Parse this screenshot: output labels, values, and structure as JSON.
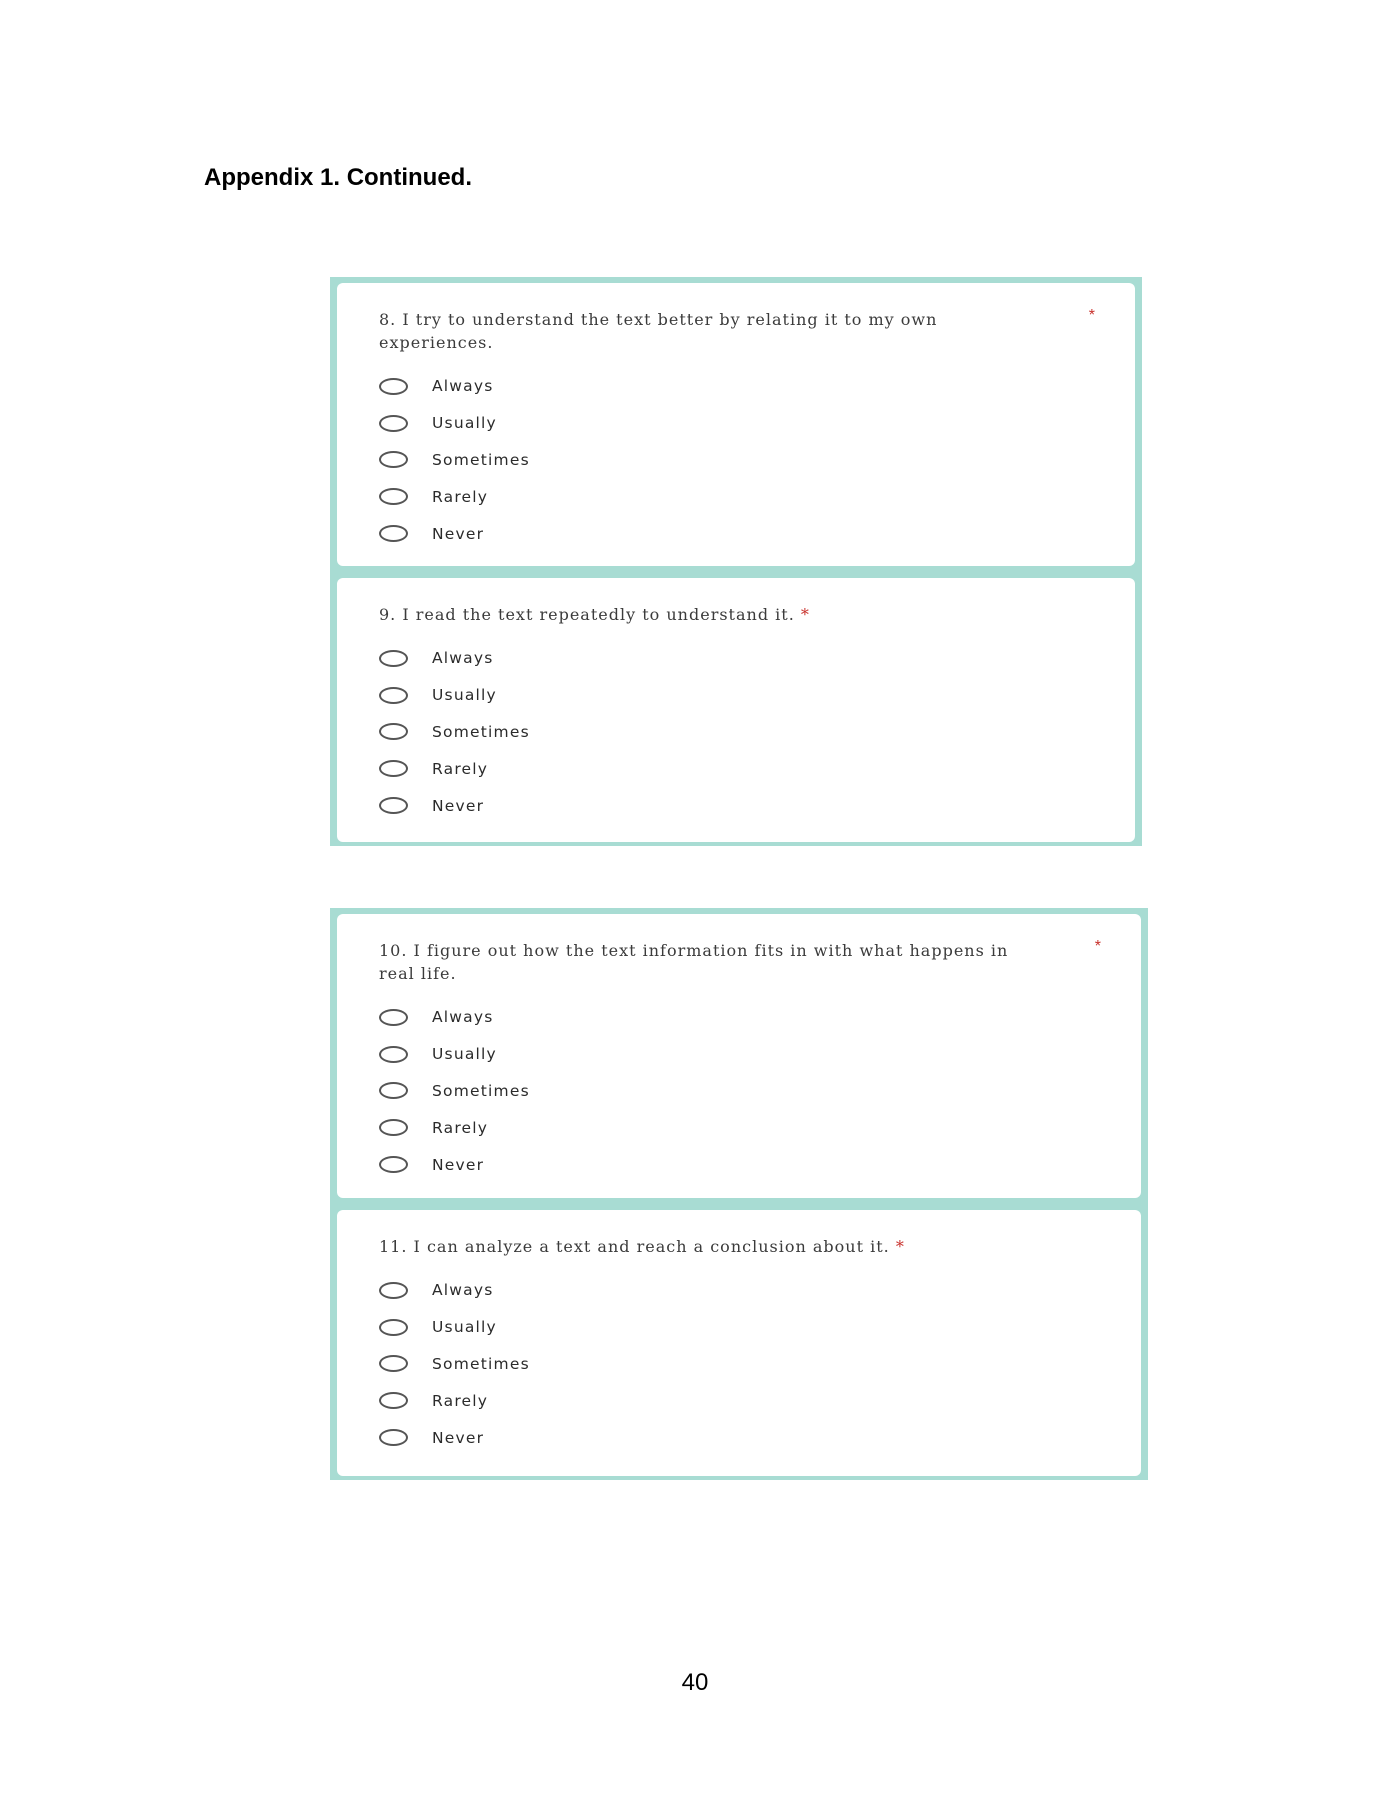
{
  "heading": "Appendix 1. Continued.",
  "questions": [
    {
      "text": "8. I try to understand the text better by relating it to my own experiences.",
      "required_marker": "*",
      "options": [
        "Always",
        "Usually",
        "Sometimes",
        "Rarely",
        "Never"
      ]
    },
    {
      "text": "9. I read the text repeatedly to understand it.",
      "required_marker": "*",
      "options": [
        "Always",
        "Usually",
        "Sometimes",
        "Rarely",
        "Never"
      ]
    },
    {
      "text": "10. I figure out how the text information fits in with what happens in real life.",
      "required_marker": "*",
      "options": [
        "Always",
        "Usually",
        "Sometimes",
        "Rarely",
        "Never"
      ]
    },
    {
      "text": "11. I can analyze a text and reach a conclusion about it.",
      "required_marker": "*",
      "options": [
        "Always",
        "Usually",
        "Sometimes",
        "Rarely",
        "Never"
      ]
    }
  ],
  "page_number": "40",
  "colors": {
    "frame": "#a8dcd3",
    "required": "#c8302b"
  }
}
